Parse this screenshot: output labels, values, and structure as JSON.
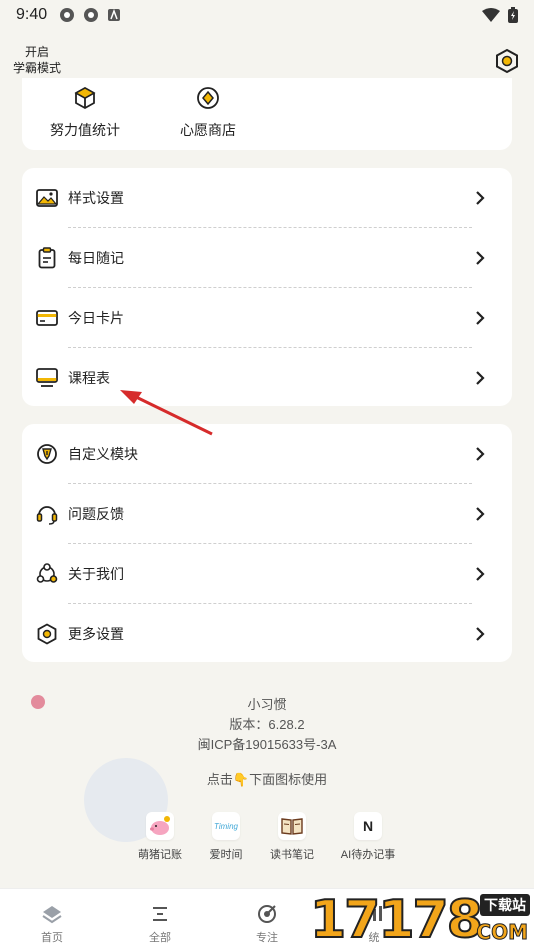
{
  "status_bar": {
    "time": "9:40"
  },
  "header": {
    "mode_line1": "开启",
    "mode_line2": "学霸模式"
  },
  "stats": [
    {
      "label": "努力值统计",
      "icon": "cube-icon"
    },
    {
      "label": "心愿商店",
      "icon": "wish-shop-icon"
    }
  ],
  "menu1": [
    {
      "label": "样式设置",
      "icon": "image-icon"
    },
    {
      "label": "每日随记",
      "icon": "clipboard-icon"
    },
    {
      "label": "今日卡片",
      "icon": "card-icon"
    },
    {
      "label": "课程表",
      "icon": "monitor-icon"
    }
  ],
  "menu2": [
    {
      "label": "自定义模块",
      "icon": "shield-icon"
    },
    {
      "label": "问题反馈",
      "icon": "headset-icon"
    },
    {
      "label": "关于我们",
      "icon": "people-icon"
    },
    {
      "label": "更多设置",
      "icon": "hex-gear-icon"
    }
  ],
  "info": {
    "app_name": "小习惯",
    "version": "版本：6.28.2",
    "icp": "闽ICP备19015633号-3A",
    "hint": "点击👇下面图标使用"
  },
  "apps": [
    {
      "label": "萌猪记账",
      "icon": "pig-icon"
    },
    {
      "label": "爱时间",
      "icon": "timing-icon",
      "glyph": "Timing"
    },
    {
      "label": "读书笔记",
      "icon": "book-icon"
    },
    {
      "label": "AI待办记事",
      "icon": "n-icon",
      "glyph": "N"
    }
  ],
  "nav": [
    {
      "label": "首页",
      "icon": "home-icon"
    },
    {
      "label": "全部",
      "icon": "list-icon"
    },
    {
      "label": "专注",
      "icon": "focus-icon"
    },
    {
      "label": "统",
      "icon": "stats-icon"
    }
  ],
  "watermark": {
    "number": "17178",
    "tag": "下载站",
    "domain": "COM"
  },
  "colors": {
    "accent": "#f2b705",
    "pink": "#e38b9c",
    "arrow": "#d62b2b"
  }
}
